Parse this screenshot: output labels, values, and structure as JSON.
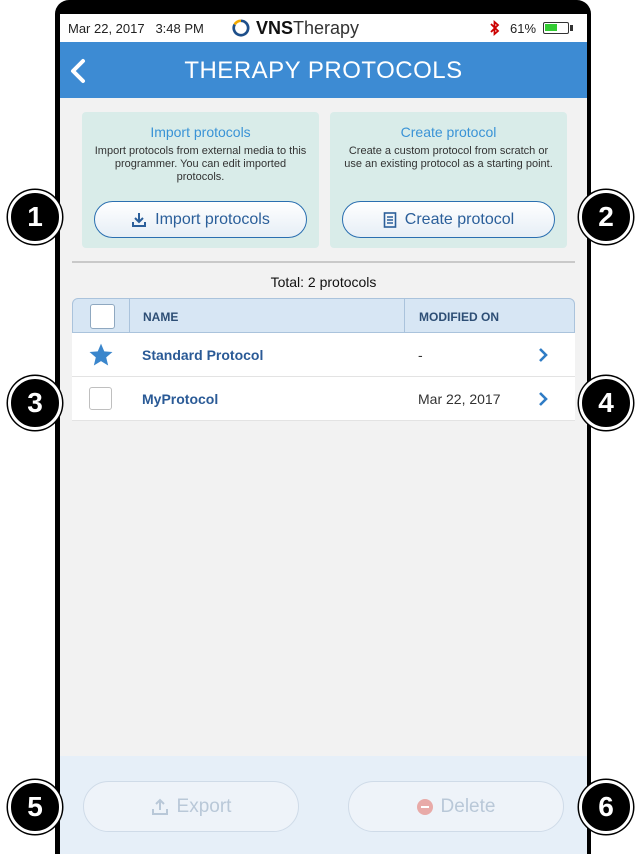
{
  "status_bar": {
    "date": "Mar 22, 2017",
    "time": "3:48 PM",
    "brand_bold": "VNS",
    "brand_light": "Therapy",
    "battery_percent": "61%",
    "battery_level": 0.61,
    "battery_color": "#33cc33"
  },
  "header": {
    "title": "THERAPY PROTOCOLS",
    "back_icon": "chevron-left-icon",
    "background": "#3d8bd3"
  },
  "import_card": {
    "title": "Import protocols",
    "description": "Import protocols from external media to this programmer. You can edit imported protocols.",
    "button_label": "Import protocols",
    "button_icon": "download-icon"
  },
  "create_card": {
    "title": "Create protocol",
    "description": "Create a custom protocol from scratch or use an existing protocol as a starting point.",
    "button_label": "Create protocol",
    "button_icon": "document-icon"
  },
  "list": {
    "total_label": "Total: 2 protocols",
    "columns": {
      "name": "NAME",
      "modified": "MODIFIED ON"
    },
    "rows": [
      {
        "name": "Standard Protocol",
        "modified": "-",
        "marker": "star-icon"
      },
      {
        "name": "MyProtocol",
        "modified": "Mar 22, 2017",
        "marker": "checkbox"
      }
    ]
  },
  "footer": {
    "export_label": "Export",
    "delete_label": "Delete",
    "export_icon": "upload-icon",
    "delete_icon": "minus-circle-icon"
  },
  "callouts": [
    "1",
    "2",
    "3",
    "4",
    "5",
    "6"
  ]
}
